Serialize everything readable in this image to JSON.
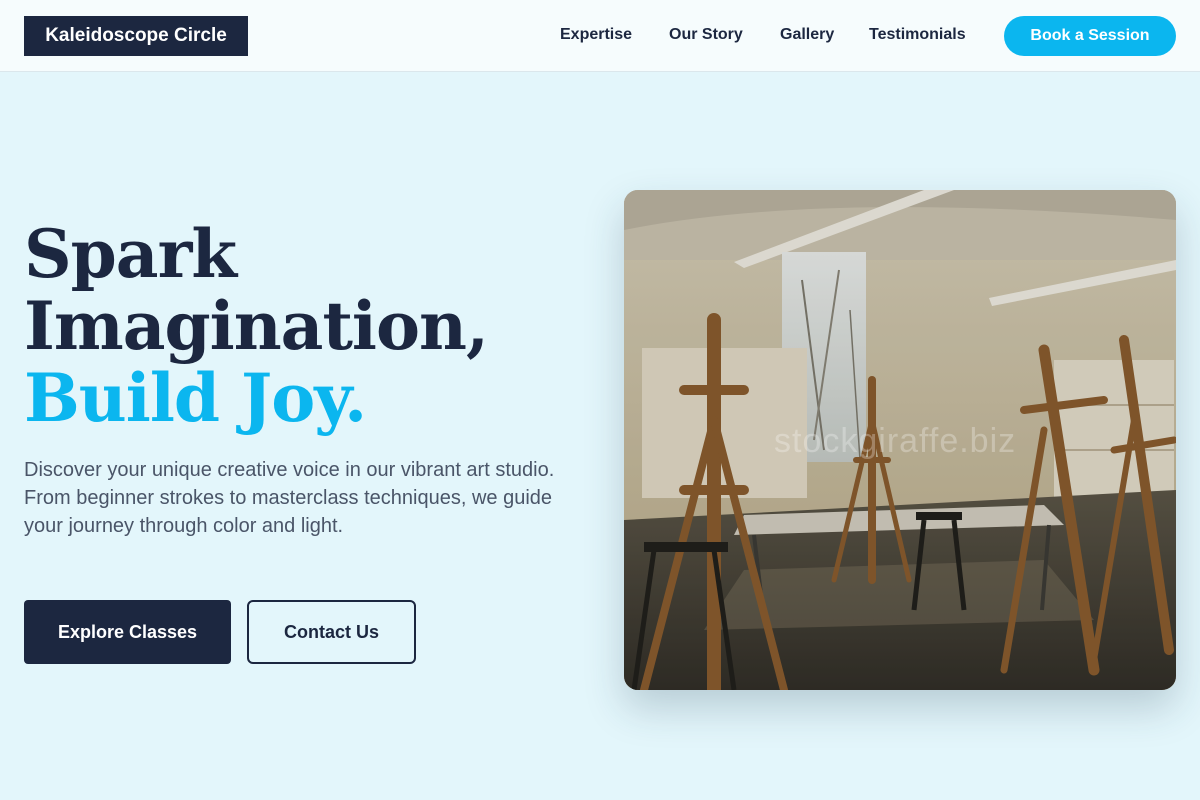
{
  "header": {
    "logo": "Kaleidoscope Circle",
    "nav": [
      "Expertise",
      "Our Story",
      "Gallery",
      "Testimonials"
    ],
    "cta": "Book a Session"
  },
  "hero": {
    "title_line1": "Spark",
    "title_line2": "Imagination,",
    "title_line3": "Build Joy.",
    "description": "Discover your unique creative voice in our vibrant art studio. From beginner strokes to masterclass techniques, we guide your journey through color and light.",
    "primary_button": "Explore Classes",
    "secondary_button": "Contact Us",
    "image_watermark": "stockgiraffe.biz"
  },
  "colors": {
    "primary_dark": "#1c2740",
    "accent": "#0bb6ef",
    "background": "#e3f6fb"
  }
}
